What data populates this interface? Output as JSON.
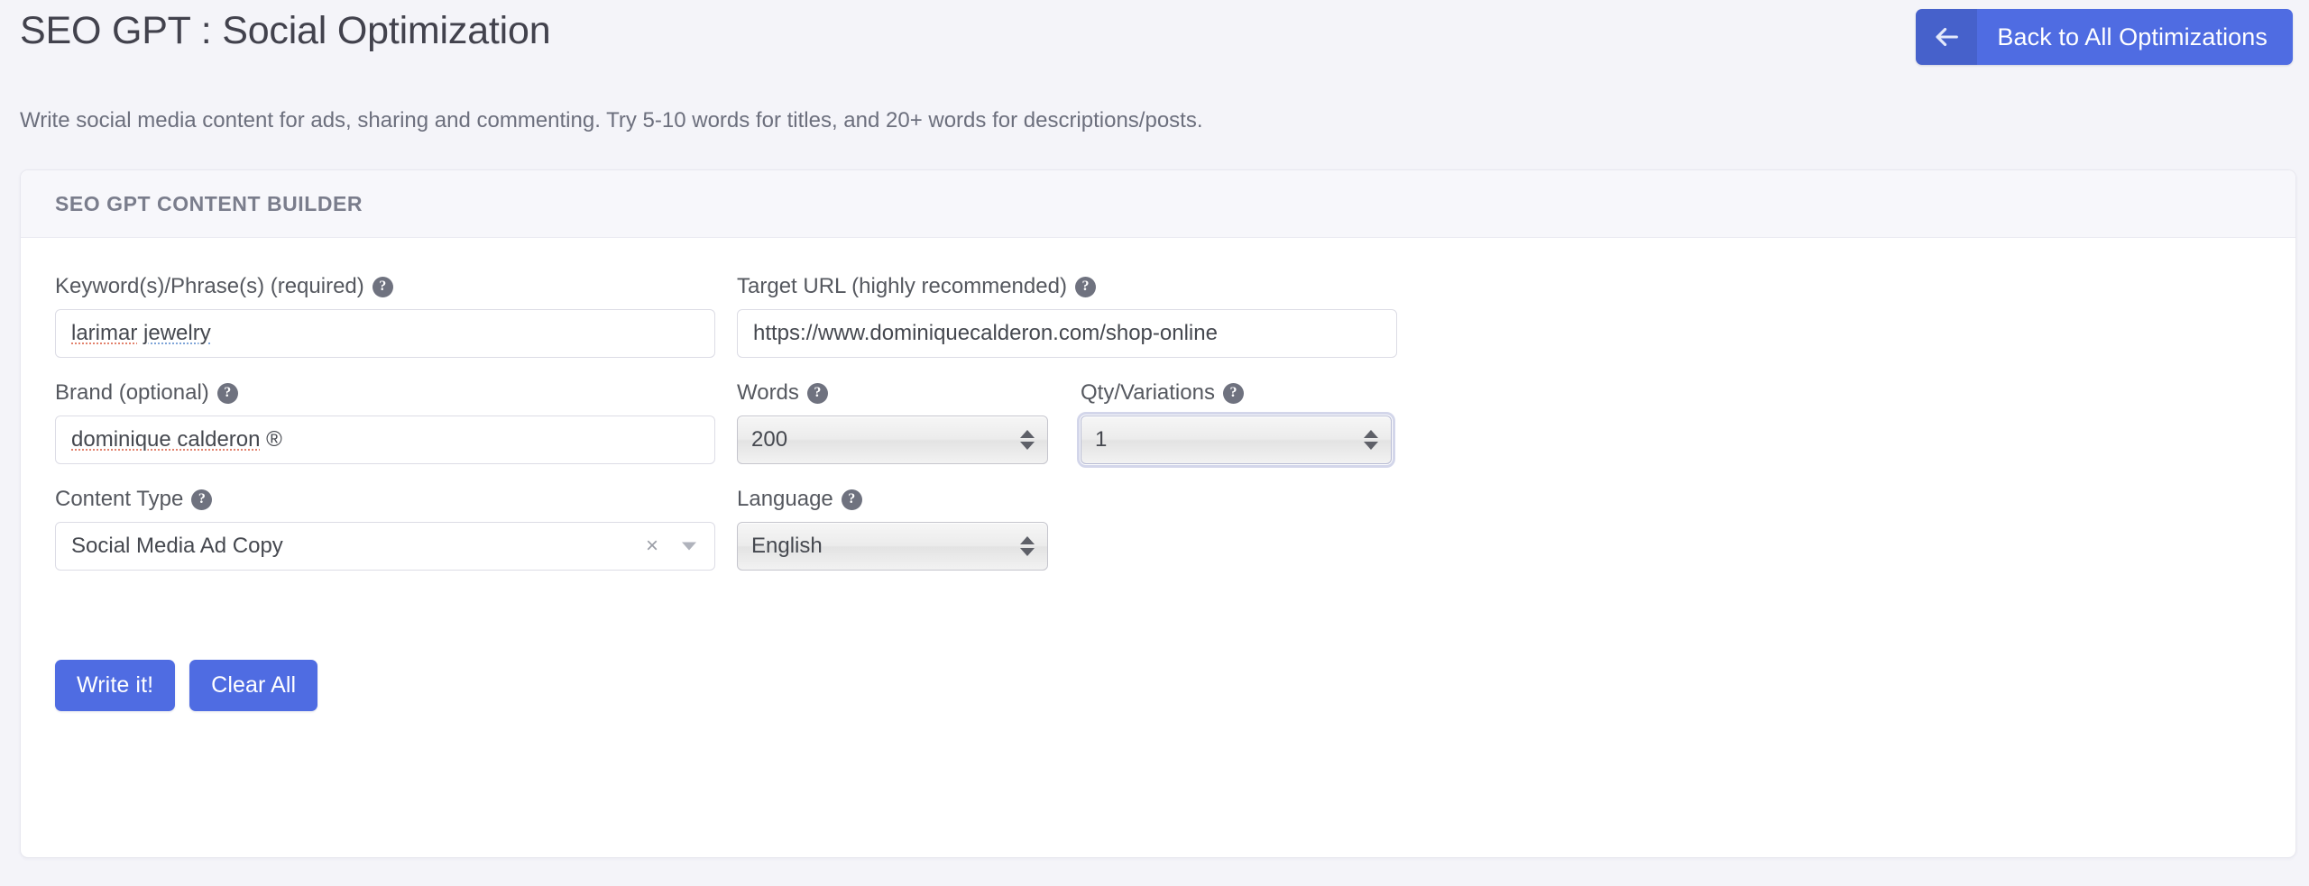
{
  "header": {
    "title": "SEO GPT : Social Optimization",
    "back_button_label": "Back to All Optimizations",
    "back_icon": "arrow-left-icon",
    "subtitle": "Write social media content for ads, sharing and commenting. Try 5-10 words for titles, and 20+ words for descriptions/posts."
  },
  "card": {
    "header_title": "SEO GPT CONTENT BUILDER"
  },
  "fields": {
    "keyword": {
      "label": "Keyword(s)/Phrase(s) (required)",
      "help": "?",
      "value_part1": "larimar",
      "value_part2": "jewelry",
      "value": "larimar jewelry"
    },
    "target_url": {
      "label": "Target URL (highly recommended)",
      "help": "?",
      "value": "https://www.dominiquecalderon.com/shop-online"
    },
    "brand": {
      "label": "Brand (optional)",
      "help": "?",
      "value_part1": "dominique calderon",
      "value_part2": "®",
      "value": "dominique calderon ®"
    },
    "words": {
      "label": "Words",
      "help": "?",
      "value": "200"
    },
    "qty": {
      "label": "Qty/Variations",
      "help": "?",
      "value": "1"
    },
    "content_type": {
      "label": "Content Type",
      "help": "?",
      "value": "Social Media Ad Copy",
      "clear_glyph": "×"
    },
    "language": {
      "label": "Language",
      "help": "?",
      "value": "English"
    }
  },
  "actions": {
    "write_label": "Write it!",
    "clear_label": "Clear All"
  },
  "colors": {
    "accent_blue": "#4f6ce2",
    "page_background": "#f4f4f9",
    "card_header_background": "#f7f7fb",
    "label_text": "#55585f",
    "muted_text": "#6c6f7d"
  }
}
